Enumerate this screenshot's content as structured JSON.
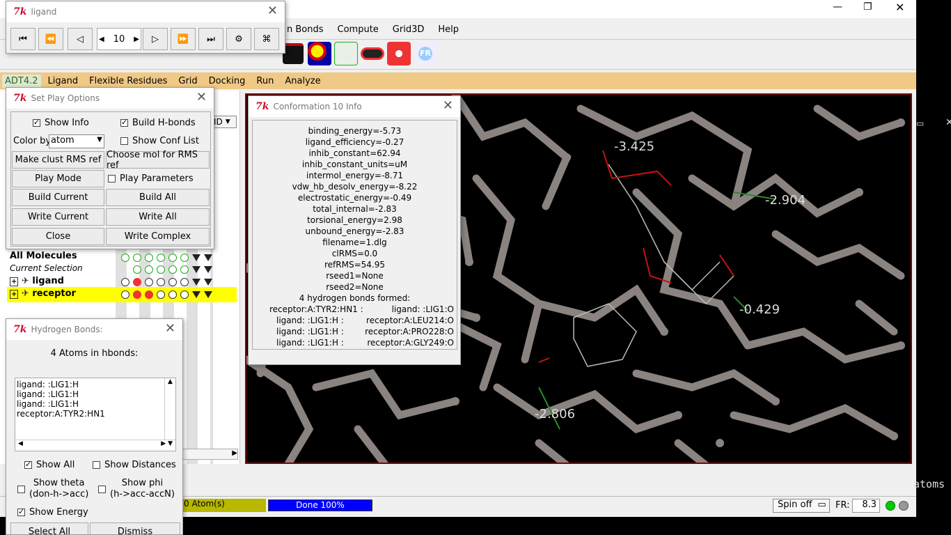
{
  "main_window": {
    "menus": [
      "n Bonds",
      "Compute",
      "Grid3D",
      "Help"
    ],
    "adt_menus": [
      "ADT4.2",
      "Ligand",
      "Flexible Residues",
      "Grid",
      "Docking",
      "Run",
      "Analyze"
    ],
    "window_controls": [
      "—",
      "❐",
      "✕"
    ]
  },
  "ligand_player": {
    "title": "ligand",
    "frame_value": "10",
    "buttons": [
      "⏮",
      "⏪",
      "◁",
      "▷",
      "⏩",
      "⏭",
      "⚙",
      "⌘"
    ]
  },
  "set_play_options": {
    "title": "Set Play Options",
    "show_info": "Show Info",
    "build_hbonds": "Build  H-bonds",
    "color_by_label": "Color by",
    "color_by_value": "atom",
    "show_conf_list": "Show Conf List",
    "make_clust": "Make clust RMS ref",
    "choose_mol": "Choose mol for RMS ref",
    "play_mode": "Play Mode",
    "play_parameters": "Play Parameters",
    "build_current": "Build Current",
    "build_all": "Build All",
    "write_current": "Write Current",
    "write_all": "Write All",
    "close": "Close",
    "write_complex": "Write Complex"
  },
  "dashboard": {
    "id_label": "ID",
    "all_molecules": "All Molecules",
    "current_selection": "Current Selection",
    "ligand": "ligand",
    "receptor": "receptor"
  },
  "hbonds": {
    "title": "Hydrogen Bonds:",
    "header": "4 Atoms in hbonds:",
    "items": [
      "ligand: :LIG1:H",
      "ligand: :LIG1:H",
      "ligand: :LIG1:H",
      "receptor:A:TYR2:HN1"
    ],
    "show_all": "Show All",
    "show_distances": "Show Distances",
    "show_theta": "Show theta",
    "show_theta_sub": "(don-h->acc)",
    "show_phi": "Show phi",
    "show_phi_sub": "(h->acc-accN)",
    "show_energy": "Show Energy",
    "select_all": "Select All",
    "dismiss": "Dismiss"
  },
  "conf_info": {
    "title": "Conformation 10 Info",
    "lines": [
      "binding_energy=-5.73",
      "ligand_efficiency=-0.27",
      "inhib_constant=62.94",
      "inhib_constant_units=uM",
      "intermol_energy=-8.71",
      "vdw_hb_desolv_energy=-8.22",
      "electrostatic_energy=-0.49",
      "total_internal=-2.83",
      "torsional_energy=2.98",
      "unbound_energy=-2.83",
      "filename=1.dlg",
      "clRMS=0.0",
      "refRMS=54.95",
      "rseed1=None",
      "rseed2=None",
      "4 hydrogen bonds formed:"
    ],
    "bonds": [
      [
        "receptor:A:TYR2:HN1 :",
        "ligand: :LIG1:O"
      ],
      [
        "ligand: :LIG1:H :",
        "receptor:A:LEU214:O"
      ],
      [
        "ligand: :LIG1:H :",
        "receptor:A:PRO228:O"
      ],
      [
        "ligand: :LIG1:H :",
        "receptor:A:GLY249:O"
      ]
    ]
  },
  "viewer": {
    "labels": [
      "-3.425",
      "-2.904",
      "-0.429",
      "-2.806"
    ]
  },
  "status": {
    "atoms": "0 Atom(s)",
    "progress": "Done 100%",
    "progress_fraction": 1.0,
    "spin": "Spin off",
    "fr_label": "FR:",
    "fr_value": "8.3"
  },
  "background_text": "atoms",
  "colors": {
    "progress": "#0000ff",
    "selection": "#ffff00",
    "hbond": "#2a8a2a"
  }
}
